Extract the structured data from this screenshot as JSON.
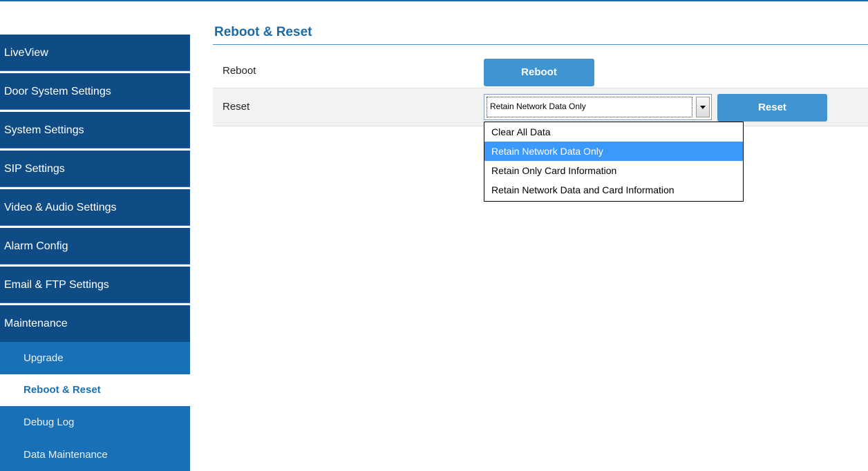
{
  "sidebar": {
    "menu": [
      {
        "label": "LiveView"
      },
      {
        "label": "Door System Settings"
      },
      {
        "label": "System Settings"
      },
      {
        "label": "SIP Settings"
      },
      {
        "label": "Video & Audio Settings"
      },
      {
        "label": "Alarm Config"
      },
      {
        "label": "Email & FTP Settings"
      },
      {
        "label": "Maintenance"
      }
    ],
    "submenu": [
      {
        "label": "Upgrade"
      },
      {
        "label": "Reboot & Reset"
      },
      {
        "label": "Debug Log"
      },
      {
        "label": "Data Maintenance"
      }
    ]
  },
  "page": {
    "title": "Reboot & Reset",
    "reboot_label": "Reboot",
    "reboot_button": "Reboot",
    "reset_label": "Reset",
    "reset_button": "Reset",
    "reset_select_value": "Retain Network Data Only",
    "reset_options": [
      "Clear All Data",
      "Retain Network Data Only",
      "Retain Only Card Information",
      "Retain Network Data and Card Information"
    ]
  },
  "colors": {
    "sidebar_menu_bg": "#0f4c85",
    "sidebar_submenu_bg": "#1a70b6",
    "accent": "#1a6aa8",
    "button": "#3f94d1",
    "option_highlight": "#3c99fc"
  }
}
